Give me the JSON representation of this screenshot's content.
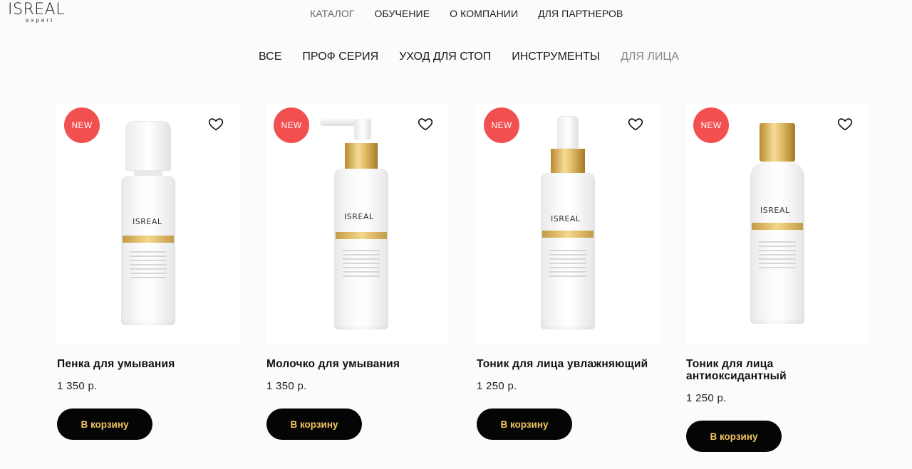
{
  "header": {
    "logo_main": "ISREAL",
    "logo_sub": "expert",
    "nav": [
      {
        "label": "КАТАЛОГ"
      },
      {
        "label": "ОБУЧЕНИЕ"
      },
      {
        "label": "О КОМПАНИИ"
      },
      {
        "label": "ДЛЯ ПАРТНЕРОВ"
      }
    ]
  },
  "categories": [
    {
      "label": "ВСЕ"
    },
    {
      "label": "ПРОФ СЕРИЯ"
    },
    {
      "label": "УХОД ДЛЯ СТОП"
    },
    {
      "label": "ИНСТРУМЕНТЫ"
    },
    {
      "label": "ДЛЯ ЛИЦА"
    }
  ],
  "products": [
    {
      "badge": "NEW",
      "title": "Пенка для умывания",
      "price": "1 350 р.",
      "button": "В корзину"
    },
    {
      "badge": "NEW",
      "title": "Молочко для умывания",
      "price": "1 350 р.",
      "button": "В корзину"
    },
    {
      "badge": "NEW",
      "title": "Тоник для лица увлажняющий",
      "price": "1 250 р.",
      "button": "В корзину"
    },
    {
      "badge": "NEW",
      "title": "Тоник для лица антиоксидантный",
      "price": "1 250 р.",
      "button": "В корзину"
    }
  ],
  "colors": {
    "badge": "#f25050",
    "button_bg": "#050505",
    "button_text": "#f1c462",
    "gold": "#d9b460"
  }
}
